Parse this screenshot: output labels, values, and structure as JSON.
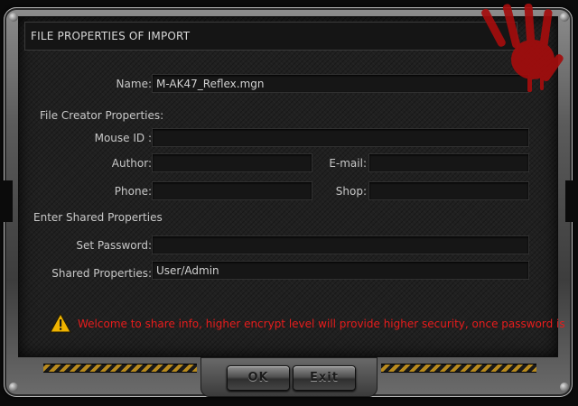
{
  "dialog": {
    "title": "FILE PROPERTIES OF IMPORT"
  },
  "form": {
    "name_label": "Name:",
    "name_value": "M-AK47_Reflex.mgn",
    "creator_section": "File Creator Properties:",
    "mouse_id_label": "Mouse ID :",
    "mouse_id_value": "",
    "author_label": "Author:",
    "author_value": "",
    "email_label": "E-mail:",
    "email_value": "",
    "phone_label": "Phone:",
    "phone_value": "",
    "shop_label": "Shop:",
    "shop_value": "",
    "shared_section": "Enter Shared Properties",
    "password_label": "Set Password:",
    "password_value": "",
    "shared_label": "Shared Properties:",
    "shared_value": "User/Admin"
  },
  "warning": {
    "text": "Welcome to share info, higher encrypt level will provide higher security, once password is forgotten",
    "color": "#e81c1c",
    "icon": "warning-triangle-icon"
  },
  "buttons": {
    "ok_label": "OK",
    "exit_label": "Exit"
  },
  "decor": {
    "brand_mark": "red-handprint-icon",
    "hazard_color": "#b88a1e"
  }
}
